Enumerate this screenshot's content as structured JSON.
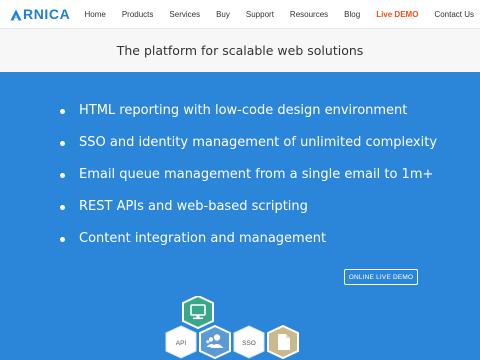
{
  "brand": {
    "logo_text": "RNICA",
    "accent": "#1f7fd4"
  },
  "nav": {
    "items": [
      {
        "label": "Home"
      },
      {
        "label": "Products"
      },
      {
        "label": "Services"
      },
      {
        "label": "Buy"
      },
      {
        "label": "Support"
      },
      {
        "label": "Resources"
      },
      {
        "label": "Blog"
      },
      {
        "label": "Live DEMO",
        "highlight": true,
        "color": "#e8541c"
      },
      {
        "label": "Contact Us"
      }
    ]
  },
  "tagline": "The platform for scalable web solutions",
  "hero": {
    "background": "#2b86d9",
    "features": [
      "HTML reporting with low-code design environment",
      "SSO and identity management of unlimited complexity",
      "Email queue management from a single email to 1m+",
      "REST APIs and web-based scripting",
      "Content integration and management"
    ],
    "demo_button": "ONLINE LIVE DEMO",
    "hex_icons": {
      "monitor": {
        "icon": "monitor-icon",
        "color": "#3aa68a"
      },
      "api": {
        "label": "API",
        "color": "#ffffff"
      },
      "users": {
        "icon": "users-icon",
        "color": "#5b9bd5"
      },
      "sso": {
        "label": "SSO",
        "color": "#ffffff"
      },
      "document": {
        "icon": "document-icon",
        "color": "#c9b98c"
      }
    }
  }
}
